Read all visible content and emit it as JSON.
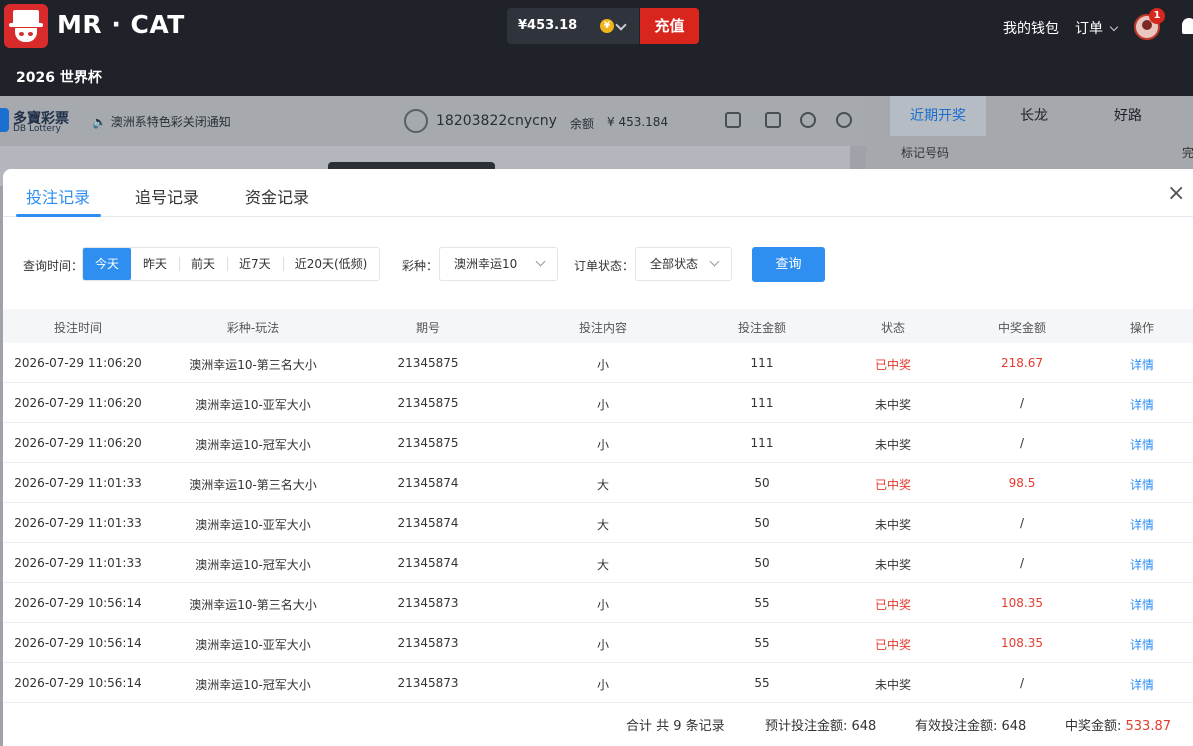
{
  "header": {
    "brand": "MR · CAT",
    "balance": "¥453.18",
    "coin_symbol": "¥",
    "recharge_label": "充值",
    "wallet_label": "我的钱包",
    "orders_label": "订单",
    "notification_count": "1",
    "subnav_label": "2026 世界杯"
  },
  "background": {
    "lottery_name": "多寶彩票",
    "lottery_sub": "DB Lottery",
    "notice": "澳洲系特色彩关闭通知",
    "username": "18203822cnycny",
    "balance_label": "余额",
    "balance_value": "¥ 453.184",
    "right_tabs": [
      "近期开奖",
      "长龙",
      "好路"
    ],
    "right_sub": "标记号码",
    "right_extra": "完"
  },
  "modal": {
    "tabs": [
      "投注记录",
      "追号记录",
      "资金记录"
    ],
    "active_tab": 0,
    "close_symbol": "×",
    "filters": {
      "time_label": "查询时间：",
      "time_options": [
        "今天",
        "昨天",
        "前天",
        "近7天",
        "近20天(低频)"
      ],
      "active_time": 0,
      "lottery_label": "彩种：",
      "lottery_value": "澳洲幸运10",
      "status_label": "订单状态：",
      "status_value": "全部状态",
      "query_label": "查询"
    },
    "columns": [
      "投注时间",
      "彩种-玩法",
      "期号",
      "投注内容",
      "投注金额",
      "状态",
      "中奖金额",
      "操作"
    ],
    "rows": [
      {
        "time": "2026-07-29 11:06:20",
        "game": "澳洲幸运10-第三名大小",
        "issue": "21345875",
        "content": "小",
        "amount": "111",
        "status": "已中奖",
        "won": true,
        "prize": "218.67",
        "action": "详情"
      },
      {
        "time": "2026-07-29 11:06:20",
        "game": "澳洲幸运10-亚军大小",
        "issue": "21345875",
        "content": "小",
        "amount": "111",
        "status": "未中奖",
        "won": false,
        "prize": "/",
        "action": "详情"
      },
      {
        "time": "2026-07-29 11:06:20",
        "game": "澳洲幸运10-冠军大小",
        "issue": "21345875",
        "content": "小",
        "amount": "111",
        "status": "未中奖",
        "won": false,
        "prize": "/",
        "action": "详情"
      },
      {
        "time": "2026-07-29 11:01:33",
        "game": "澳洲幸运10-第三名大小",
        "issue": "21345874",
        "content": "大",
        "amount": "50",
        "status": "已中奖",
        "won": true,
        "prize": "98.5",
        "action": "详情"
      },
      {
        "time": "2026-07-29 11:01:33",
        "game": "澳洲幸运10-亚军大小",
        "issue": "21345874",
        "content": "大",
        "amount": "50",
        "status": "未中奖",
        "won": false,
        "prize": "/",
        "action": "详情"
      },
      {
        "time": "2026-07-29 11:01:33",
        "game": "澳洲幸运10-冠军大小",
        "issue": "21345874",
        "content": "大",
        "amount": "50",
        "status": "未中奖",
        "won": false,
        "prize": "/",
        "action": "详情"
      },
      {
        "time": "2026-07-29 10:56:14",
        "game": "澳洲幸运10-第三名大小",
        "issue": "21345873",
        "content": "小",
        "amount": "55",
        "status": "已中奖",
        "won": true,
        "prize": "108.35",
        "action": "详情"
      },
      {
        "time": "2026-07-29 10:56:14",
        "game": "澳洲幸运10-亚军大小",
        "issue": "21345873",
        "content": "小",
        "amount": "55",
        "status": "已中奖",
        "won": true,
        "prize": "108.35",
        "action": "详情"
      },
      {
        "time": "2026-07-29 10:56:14",
        "game": "澳洲幸运10-冠军大小",
        "issue": "21345873",
        "content": "小",
        "amount": "55",
        "status": "未中奖",
        "won": false,
        "prize": "/",
        "action": "详情"
      }
    ],
    "summary": {
      "total_records": "合计 共 9 条记录",
      "expected_label": "预计投注金额: ",
      "expected_value": "648",
      "valid_label": "有效投注金额: ",
      "valid_value": "648",
      "prize_label": "中奖金额: ",
      "prize_value": "533.87"
    }
  },
  "colors": {
    "accent": "#2e8ff0",
    "win": "#e23b2e",
    "recharge": "#d9261c",
    "header_bg": "#1f2229"
  }
}
